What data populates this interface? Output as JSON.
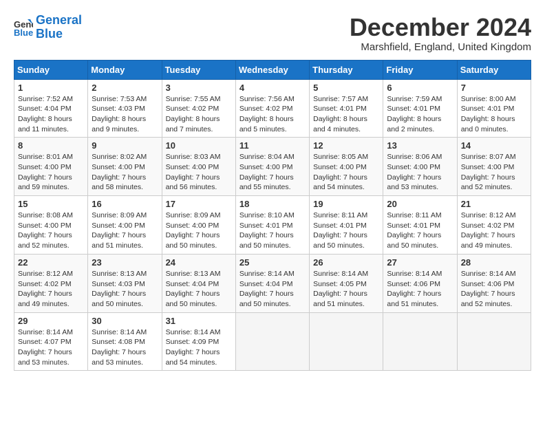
{
  "logo": {
    "line1": "General",
    "line2": "Blue"
  },
  "title": "December 2024",
  "subtitle": "Marshfield, England, United Kingdom",
  "weekdays": [
    "Sunday",
    "Monday",
    "Tuesday",
    "Wednesday",
    "Thursday",
    "Friday",
    "Saturday"
  ],
  "weeks": [
    [
      {
        "day": "1",
        "info": "Sunrise: 7:52 AM\nSunset: 4:04 PM\nDaylight: 8 hours\nand 11 minutes."
      },
      {
        "day": "2",
        "info": "Sunrise: 7:53 AM\nSunset: 4:03 PM\nDaylight: 8 hours\nand 9 minutes."
      },
      {
        "day": "3",
        "info": "Sunrise: 7:55 AM\nSunset: 4:02 PM\nDaylight: 8 hours\nand 7 minutes."
      },
      {
        "day": "4",
        "info": "Sunrise: 7:56 AM\nSunset: 4:02 PM\nDaylight: 8 hours\nand 5 minutes."
      },
      {
        "day": "5",
        "info": "Sunrise: 7:57 AM\nSunset: 4:01 PM\nDaylight: 8 hours\nand 4 minutes."
      },
      {
        "day": "6",
        "info": "Sunrise: 7:59 AM\nSunset: 4:01 PM\nDaylight: 8 hours\nand 2 minutes."
      },
      {
        "day": "7",
        "info": "Sunrise: 8:00 AM\nSunset: 4:01 PM\nDaylight: 8 hours\nand 0 minutes."
      }
    ],
    [
      {
        "day": "8",
        "info": "Sunrise: 8:01 AM\nSunset: 4:00 PM\nDaylight: 7 hours\nand 59 minutes."
      },
      {
        "day": "9",
        "info": "Sunrise: 8:02 AM\nSunset: 4:00 PM\nDaylight: 7 hours\nand 58 minutes."
      },
      {
        "day": "10",
        "info": "Sunrise: 8:03 AM\nSunset: 4:00 PM\nDaylight: 7 hours\nand 56 minutes."
      },
      {
        "day": "11",
        "info": "Sunrise: 8:04 AM\nSunset: 4:00 PM\nDaylight: 7 hours\nand 55 minutes."
      },
      {
        "day": "12",
        "info": "Sunrise: 8:05 AM\nSunset: 4:00 PM\nDaylight: 7 hours\nand 54 minutes."
      },
      {
        "day": "13",
        "info": "Sunrise: 8:06 AM\nSunset: 4:00 PM\nDaylight: 7 hours\nand 53 minutes."
      },
      {
        "day": "14",
        "info": "Sunrise: 8:07 AM\nSunset: 4:00 PM\nDaylight: 7 hours\nand 52 minutes."
      }
    ],
    [
      {
        "day": "15",
        "info": "Sunrise: 8:08 AM\nSunset: 4:00 PM\nDaylight: 7 hours\nand 52 minutes."
      },
      {
        "day": "16",
        "info": "Sunrise: 8:09 AM\nSunset: 4:00 PM\nDaylight: 7 hours\nand 51 minutes."
      },
      {
        "day": "17",
        "info": "Sunrise: 8:09 AM\nSunset: 4:00 PM\nDaylight: 7 hours\nand 50 minutes."
      },
      {
        "day": "18",
        "info": "Sunrise: 8:10 AM\nSunset: 4:01 PM\nDaylight: 7 hours\nand 50 minutes."
      },
      {
        "day": "19",
        "info": "Sunrise: 8:11 AM\nSunset: 4:01 PM\nDaylight: 7 hours\nand 50 minutes."
      },
      {
        "day": "20",
        "info": "Sunrise: 8:11 AM\nSunset: 4:01 PM\nDaylight: 7 hours\nand 50 minutes."
      },
      {
        "day": "21",
        "info": "Sunrise: 8:12 AM\nSunset: 4:02 PM\nDaylight: 7 hours\nand 49 minutes."
      }
    ],
    [
      {
        "day": "22",
        "info": "Sunrise: 8:12 AM\nSunset: 4:02 PM\nDaylight: 7 hours\nand 49 minutes."
      },
      {
        "day": "23",
        "info": "Sunrise: 8:13 AM\nSunset: 4:03 PM\nDaylight: 7 hours\nand 50 minutes."
      },
      {
        "day": "24",
        "info": "Sunrise: 8:13 AM\nSunset: 4:04 PM\nDaylight: 7 hours\nand 50 minutes."
      },
      {
        "day": "25",
        "info": "Sunrise: 8:14 AM\nSunset: 4:04 PM\nDaylight: 7 hours\nand 50 minutes."
      },
      {
        "day": "26",
        "info": "Sunrise: 8:14 AM\nSunset: 4:05 PM\nDaylight: 7 hours\nand 51 minutes."
      },
      {
        "day": "27",
        "info": "Sunrise: 8:14 AM\nSunset: 4:06 PM\nDaylight: 7 hours\nand 51 minutes."
      },
      {
        "day": "28",
        "info": "Sunrise: 8:14 AM\nSunset: 4:06 PM\nDaylight: 7 hours\nand 52 minutes."
      }
    ],
    [
      {
        "day": "29",
        "info": "Sunrise: 8:14 AM\nSunset: 4:07 PM\nDaylight: 7 hours\nand 53 minutes."
      },
      {
        "day": "30",
        "info": "Sunrise: 8:14 AM\nSunset: 4:08 PM\nDaylight: 7 hours\nand 53 minutes."
      },
      {
        "day": "31",
        "info": "Sunrise: 8:14 AM\nSunset: 4:09 PM\nDaylight: 7 hours\nand 54 minutes."
      },
      null,
      null,
      null,
      null
    ]
  ]
}
